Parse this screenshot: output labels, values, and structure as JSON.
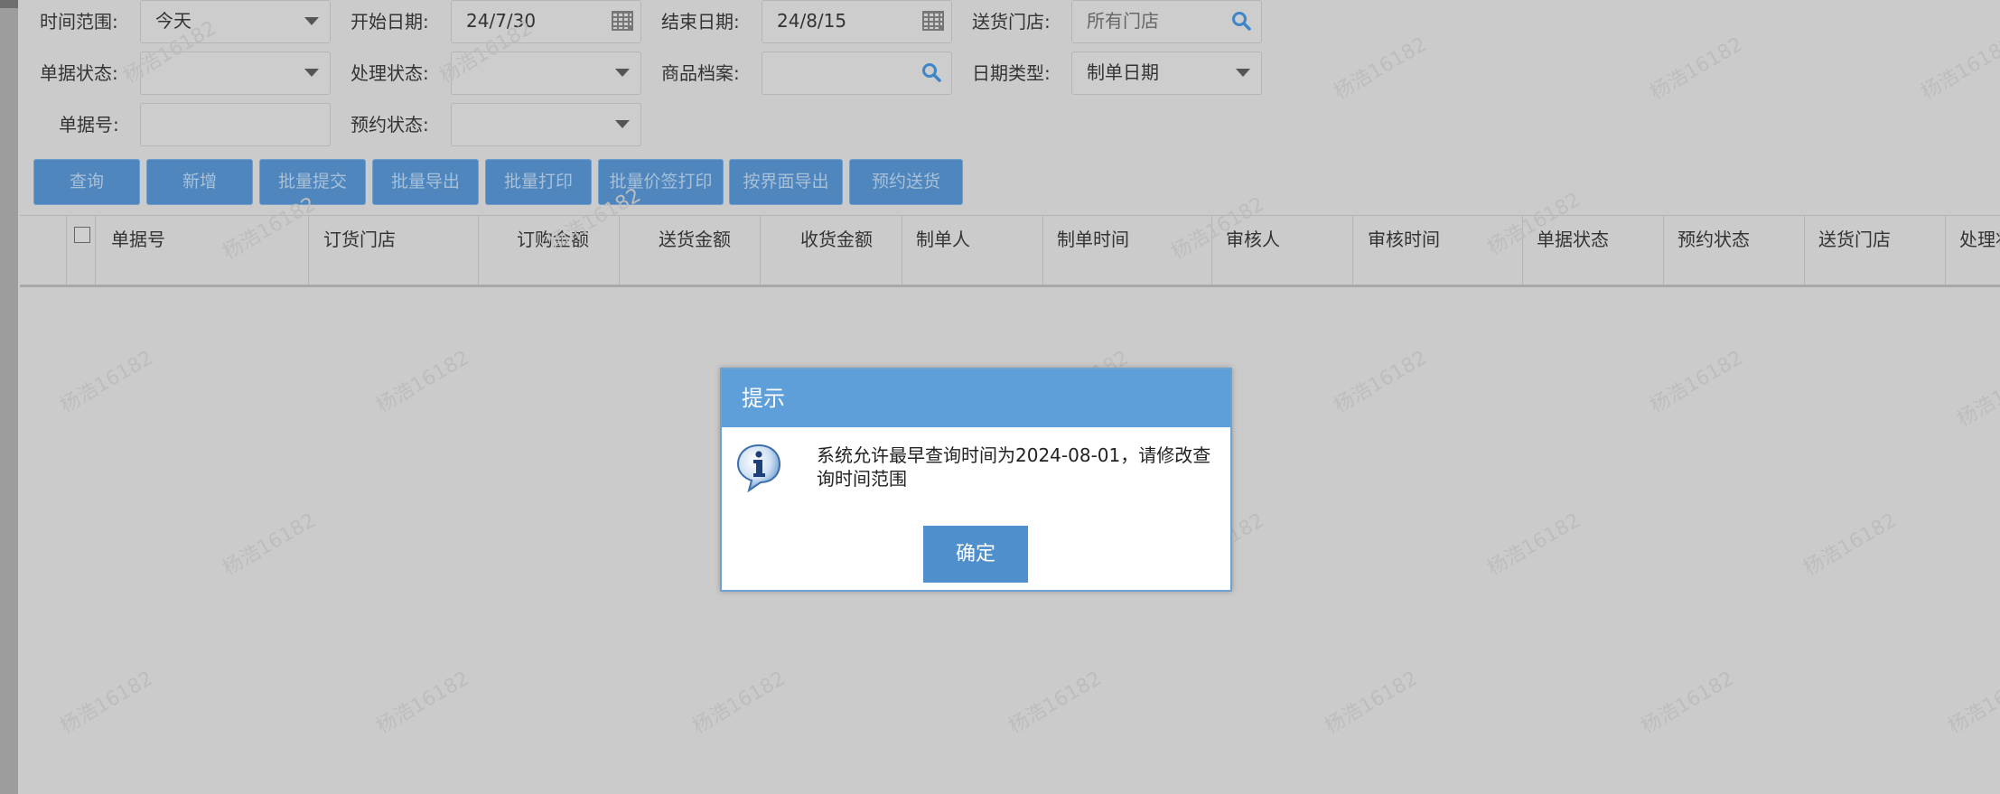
{
  "filters": {
    "time_range": {
      "label": "时间范围:",
      "value": "今天"
    },
    "start_date": {
      "label": "开始日期:",
      "value": "24/7/30"
    },
    "end_date": {
      "label": "结束日期:",
      "value": "24/8/15"
    },
    "delivery_store": {
      "label": "送货门店:",
      "placeholder": "所有门店"
    },
    "doc_status": {
      "label": "单据状态:",
      "value": ""
    },
    "process_status": {
      "label": "处理状态:",
      "value": ""
    },
    "product_archive": {
      "label": "商品档案:",
      "value": ""
    },
    "date_type": {
      "label": "日期类型:",
      "value": "制单日期"
    },
    "doc_no": {
      "label": "单据号:",
      "value": ""
    },
    "reserve_status": {
      "label": "预约状态:",
      "value": ""
    }
  },
  "toolbar": {
    "query": "查询",
    "add": "新增",
    "batch_submit": "批量提交",
    "batch_export": "批量导出",
    "batch_print": "批量打印",
    "batch_price_tag_print": "批量价签打印",
    "export_by_view": "按界面导出",
    "reserve_delivery": "预约送货"
  },
  "grid": {
    "columns": [
      "单据号",
      "订货门店",
      "订购金额",
      "送货金额",
      "收货金额",
      "制单人",
      "制单时间",
      "审核人",
      "审核时间",
      "单据状态",
      "预约状态",
      "送货门店",
      "处理状"
    ]
  },
  "watermark_text": "杨浩16182",
  "dialog": {
    "title": "提示",
    "message_line1": "系统允许最早查询时间为2024-08-01，请修改查",
    "message_line2": "询时间范围",
    "ok": "确定"
  },
  "colors": {
    "button_blue": "#4e86bd",
    "dialog_header": "#5e9fda",
    "ok_button": "#4f8fcb"
  }
}
